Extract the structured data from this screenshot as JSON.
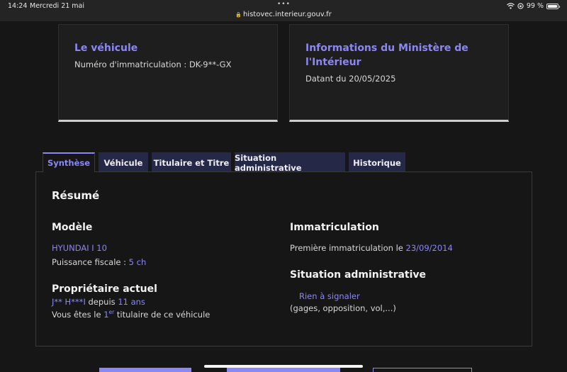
{
  "status_bar": {
    "time": "14:24",
    "date": "Mercredi 21 mai",
    "url": "histovec.interieur.gouv.fr",
    "battery": "99 %",
    "icons": [
      "wifi-icon",
      "orientation-lock-icon",
      "battery-icon",
      "lock-icon",
      "more-dots-icon"
    ]
  },
  "cards": {
    "vehicle": {
      "title": "Le véhicule",
      "text": "Numéro d'immatriculation : DK-9**-GX"
    },
    "ministry": {
      "title": "Informations du Ministère de l'Intérieur",
      "text": "Datant du 20/05/2025"
    }
  },
  "tabs": [
    {
      "label": "Synthèse",
      "active": true
    },
    {
      "label": "Véhicule",
      "active": false
    },
    {
      "label": "Titulaire et Titre",
      "active": false
    },
    {
      "label": "Situation administrative",
      "active": false
    },
    {
      "label": "Historique",
      "active": false
    }
  ],
  "summary": {
    "heading": "Résumé",
    "model": {
      "title": "Modèle",
      "name": "HYUNDAI I 10",
      "power_label": "Puissance fiscale : ",
      "power_value": "5 ch"
    },
    "owner": {
      "title": "Propriétaire actuel",
      "name": "J** H***I",
      "since_label": " depuis ",
      "since_value": "11 ans",
      "holder_prefix": "Vous êtes le ",
      "holder_rank": "1",
      "holder_sup": "er",
      "holder_suffix": " titulaire de ce véhicule"
    },
    "registration": {
      "title": "Immatriculation",
      "first_label": "Première immatriculation le ",
      "first_date": "23/09/2014"
    },
    "admin": {
      "title": "Situation administrative",
      "status": "Rien à signaler",
      "details": "(gages, opposition, vol,...)"
    }
  },
  "colors": {
    "accent": "#8b87f5",
    "background": "#161616",
    "tab_background": "#262848"
  }
}
